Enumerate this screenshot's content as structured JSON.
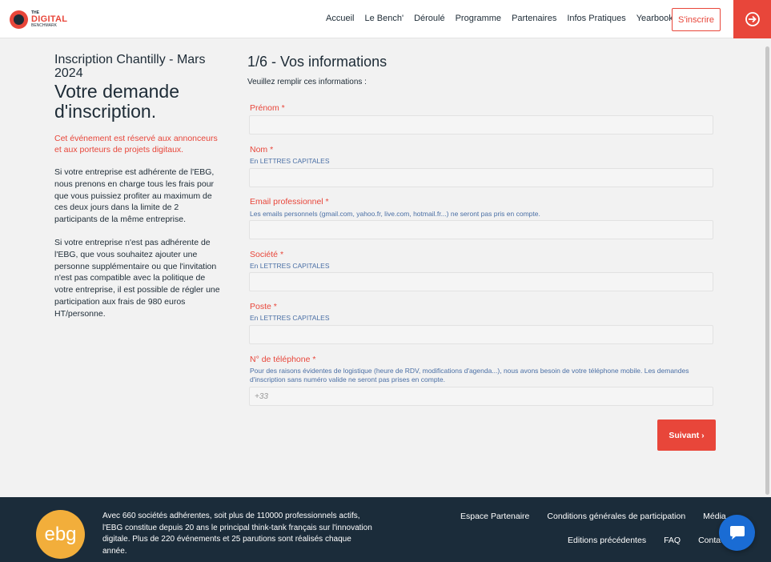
{
  "header": {
    "logo": {
      "line1": "THE",
      "line2": "DIGITAL",
      "line3": "BENCHMARK"
    },
    "nav": [
      "Accueil",
      "Le Bench'",
      "Déroulé",
      "Programme",
      "Partenaires",
      "Infos Pratiques",
      "Yearbook"
    ],
    "signup_label": "S'inscrire",
    "login_icon": "login-arrow-icon"
  },
  "left": {
    "event": "Inscription Chantilly - Mars 2024",
    "heading": "Votre demande d'inscription.",
    "notice": "Cet événement est réservé aux annonceurs et aux porteurs de projets digitaux.",
    "para1": "Si votre entreprise est adhérente de l'EBG, nous prenons en charge tous les frais pour que vous puissiez profiter au maximum de ces deux jours dans la limite de 2 participants de la même entreprise.",
    "para2": "Si votre entreprise n'est pas adhérente de l'EBG, que vous souhaitez ajouter une personne supplémentaire ou que l'invitation n'est pas compatible avec la politique de votre entreprise, il est possible de régler une participation aux frais de 980 euros HT/personne."
  },
  "form": {
    "title": "1/6 - Vos informations",
    "intro": "Veuillez remplir ces informations :",
    "fields": [
      {
        "label": "Prénom *",
        "hint": "",
        "value": ""
      },
      {
        "label": "Nom *",
        "hint": "En LETTRES CAPITALES",
        "value": ""
      },
      {
        "label": "Email professionnel *",
        "hint": "Les emails personnels (gmail.com, yahoo.fr, live.com, hotmail.fr...) ne seront pas pris en compte.",
        "value": ""
      },
      {
        "label": "Société *",
        "hint": "En LETTRES CAPITALES",
        "value": ""
      },
      {
        "label": "Poste *",
        "hint": "En LETTRES CAPITALES",
        "value": ""
      },
      {
        "label": "N° de téléphone *",
        "hint": "Pour des raisons évidentes de logistique (heure de RDV, modifications d'agenda...), nous avons besoin de votre téléphone mobile. Les demandes d'inscription sans numéro valide ne seront pas prises en compte.",
        "value": "",
        "placeholder": "+33"
      }
    ],
    "next_label": "Suivant ›"
  },
  "footer": {
    "logo": "ebg",
    "text": "Avec 660 sociétés adhérentes, soit plus de 110000 professionnels actifs, l'EBG constitue depuis 20 ans le principal think-tank français sur l'innovation digitale. Plus de 220 événements et 25 parutions sont réalisés chaque année.",
    "links_row1": [
      "Espace Partenaire",
      "Conditions générales de participation",
      "Média"
    ],
    "links_row2": [
      "Editions précédentes",
      "FAQ",
      "Contact"
    ]
  },
  "colors": {
    "accent": "#e8463a",
    "footer": "#1b2c3a",
    "chat": "#1a6cd4",
    "ebg": "#f2ae3b"
  }
}
